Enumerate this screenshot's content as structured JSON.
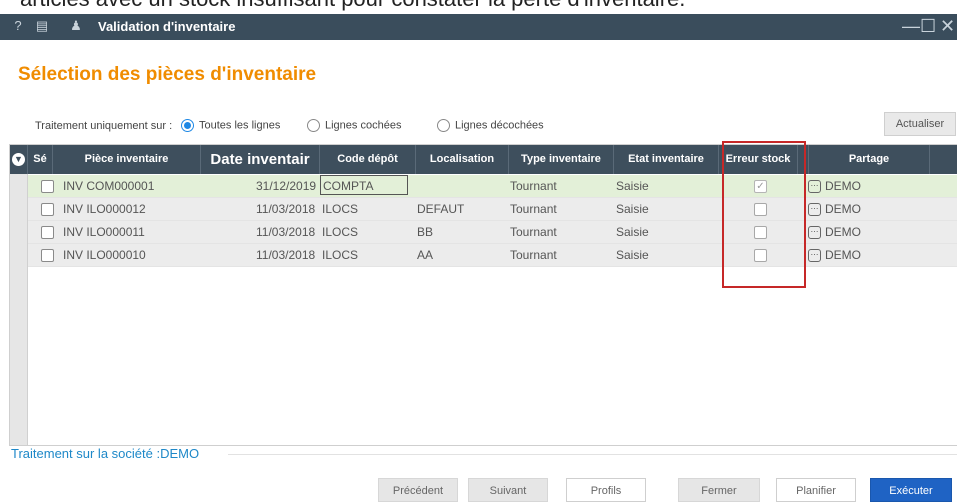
{
  "caption": "articles avec un stock insuffisant pour constater la perte d'inventaire.",
  "window": {
    "title": "Validation d'inventaire",
    "icons": [
      "help-icon",
      "document-icon",
      "user-stock-icon"
    ],
    "controls": [
      "minimize-icon",
      "maximize-icon",
      "close-icon"
    ]
  },
  "section_title": "Sélection des pièces d'inventaire",
  "filter": {
    "label": "Traitement uniquement sur :",
    "options": [
      {
        "label": "Toutes les lignes",
        "selected": true
      },
      {
        "label": "Lignes cochées",
        "selected": false
      },
      {
        "label": "Lignes décochées",
        "selected": false
      }
    ]
  },
  "refresh_label": "Actualiser",
  "table": {
    "columns": {
      "select": "Sé",
      "piece": "Pièce inventaire",
      "date": "Date inventair",
      "depot": "Code dépôt",
      "loc": "Localisation",
      "type": "Type inventaire",
      "state": "Etat inventaire",
      "error": "Erreur stock",
      "share": "Partage"
    },
    "rows": [
      {
        "piece": "INV COM000001",
        "date": "31/12/2019",
        "depot": "COMPTA",
        "loc": "",
        "type": "Tournant",
        "state": "Saisie",
        "error_checked": true,
        "share": "DEMO"
      },
      {
        "piece": "INV ILO000012",
        "date": "11/03/2018",
        "depot": "ILOCS",
        "loc": "DEFAUT",
        "type": "Tournant",
        "state": "Saisie",
        "error_checked": false,
        "share": "DEMO"
      },
      {
        "piece": "INV ILO000011",
        "date": "11/03/2018",
        "depot": "ILOCS",
        "loc": "BB",
        "type": "Tournant",
        "state": "Saisie",
        "error_checked": false,
        "share": "DEMO"
      },
      {
        "piece": "INV ILO000010",
        "date": "11/03/2018",
        "depot": "ILOCS",
        "loc": "AA",
        "type": "Tournant",
        "state": "Saisie",
        "error_checked": false,
        "share": "DEMO"
      }
    ]
  },
  "company_text": "Traitement sur la société :DEMO",
  "footer": {
    "previous": "Précédent",
    "next": "Suivant",
    "profiles": "Profils",
    "close": "Fermer",
    "schedule": "Planifier",
    "execute": "Exécuter"
  },
  "colors": {
    "accent": "#f08c00",
    "header": "#3e4f5d",
    "primary": "#1f63c4",
    "highlight": "#c62828"
  }
}
